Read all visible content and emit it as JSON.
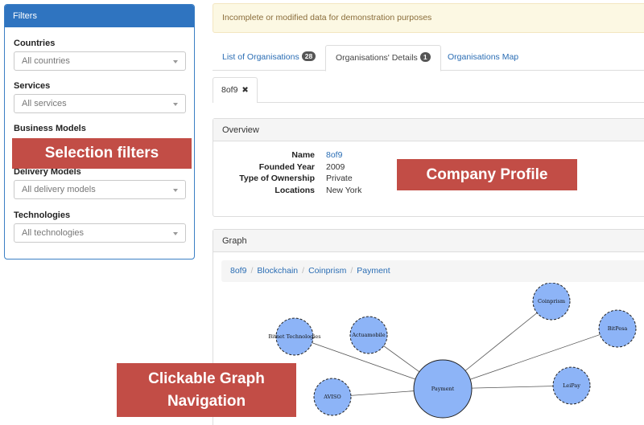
{
  "filters": {
    "title": "Filters",
    "groups": [
      {
        "label": "Countries",
        "value": "All countries"
      },
      {
        "label": "Services",
        "value": "All services"
      },
      {
        "label": "Business Models",
        "value": ""
      },
      {
        "label": "Delivery Models",
        "value": "All delivery models"
      },
      {
        "label": "Technologies",
        "value": "All technologies"
      }
    ]
  },
  "callouts": {
    "filters": "Selection filters",
    "profile": "Company Profile",
    "graph_line1": "Clickable Graph",
    "graph_line2": "Navigation",
    "color": "#c24d46"
  },
  "alert": "Incomplete or modified data for demonstration purposes",
  "tabs": [
    {
      "label": "List of Organisations",
      "badge": "28"
    },
    {
      "label": "Organisations' Details",
      "badge": "1"
    },
    {
      "label": "Organisations Map"
    }
  ],
  "selected_org": {
    "label": "8of9",
    "close_icon": "✖"
  },
  "overview": {
    "title": "Overview",
    "rows": [
      {
        "key": "Name",
        "value": "8of9",
        "link": true
      },
      {
        "key": "Founded Year",
        "value": "2009"
      },
      {
        "key": "Type of Ownership",
        "value": "Private"
      },
      {
        "key": "Locations",
        "value": "New York"
      }
    ]
  },
  "graph": {
    "title": "Graph",
    "breadcrumb": [
      "8of9",
      "Blockchain",
      "Coinprism",
      "Payment"
    ],
    "center_node": "Payment",
    "nodes": [
      "Bitnet Technologies",
      "Actuamobile",
      "Coinprism",
      "BitPesa",
      "LeiPay",
      "AVISO"
    ]
  },
  "colors": {
    "primary": "#2f74c0",
    "link": "#2a6db4",
    "node_fill": "#8db4f7",
    "alert_bg": "#fcf8e3"
  }
}
